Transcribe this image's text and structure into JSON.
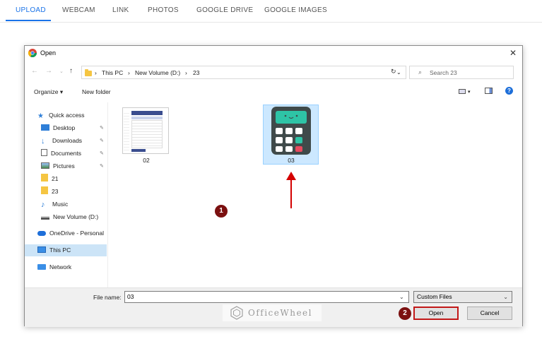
{
  "tabs": [
    {
      "label": "UPLOAD"
    },
    {
      "label": "WEBCAM"
    },
    {
      "label": "LINK"
    },
    {
      "label": "PHOTOS"
    },
    {
      "label": "GOOGLE DRIVE"
    },
    {
      "label": "GOOGLE IMAGES"
    }
  ],
  "dialog": {
    "title": "Open",
    "close": "✕",
    "breadcrumb": [
      "This PC",
      "New Volume (D:)",
      "23"
    ],
    "search_placeholder": "Search 23",
    "toolbar": {
      "organize": "Organize ▾",
      "new_folder": "New folder"
    },
    "sidebar": [
      {
        "label": "Quick access",
        "icon": "star-icon"
      },
      {
        "label": "Desktop",
        "icon": "desktop-icon",
        "pinned": true
      },
      {
        "label": "Downloads",
        "icon": "download-icon",
        "pinned": true
      },
      {
        "label": "Documents",
        "icon": "documents-icon",
        "pinned": true
      },
      {
        "label": "Pictures",
        "icon": "pictures-icon",
        "pinned": true
      },
      {
        "label": "21",
        "icon": "folder-icon"
      },
      {
        "label": "23",
        "icon": "folder-icon"
      },
      {
        "label": "Music",
        "icon": "music-icon"
      },
      {
        "label": "New Volume (D:)",
        "icon": "drive-icon"
      },
      {
        "label": "OneDrive - Personal",
        "icon": "cloud-icon"
      },
      {
        "label": "This PC",
        "icon": "pc-icon",
        "selected": true
      },
      {
        "label": "Network",
        "icon": "network-icon"
      }
    ],
    "files": [
      {
        "name": "02"
      },
      {
        "name": "03",
        "selected": true
      }
    ],
    "file_name_label": "File name:",
    "file_name_value": "03",
    "file_type": "Custom Files",
    "open_button": "Open",
    "cancel_button": "Cancel"
  },
  "annotations": {
    "step1": "1",
    "step2": "2"
  },
  "watermark": "OfficeWheel",
  "colors": {
    "accent": "#1a73e8",
    "annotation_red": "#d40000",
    "badge": "#7b1010",
    "selection": "#cce8ff"
  }
}
